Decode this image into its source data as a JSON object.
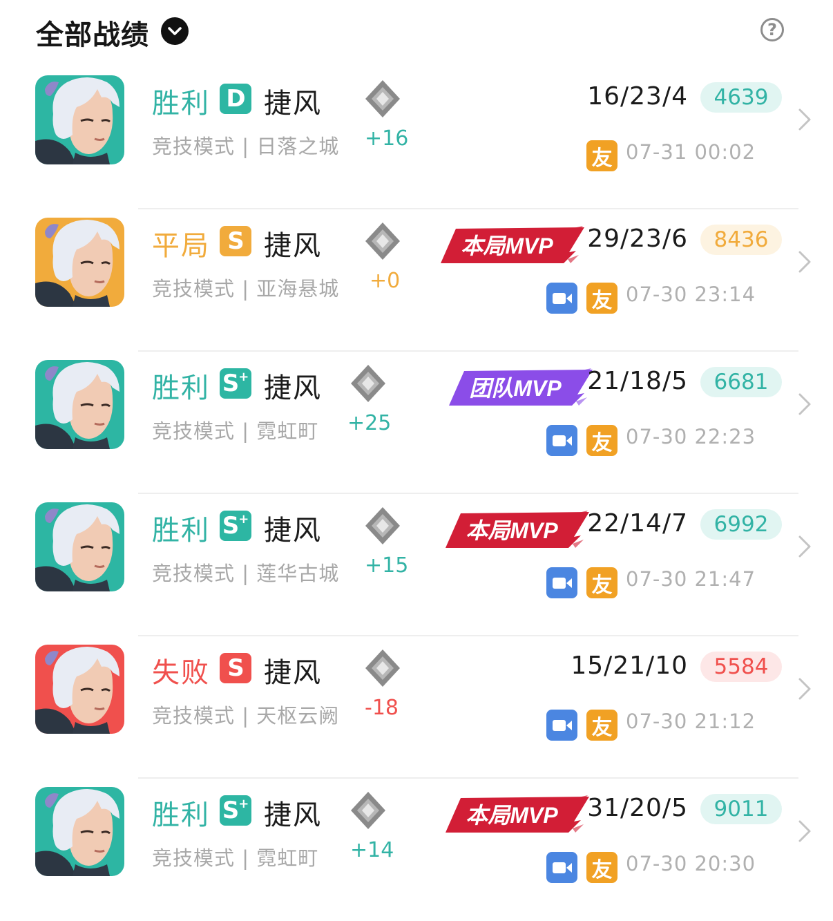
{
  "header": {
    "title": "全部战绩",
    "help_symbol": "?"
  },
  "colors": {
    "win": "#32b3a5",
    "draw": "#f1ab3c",
    "loss": "#f0504d",
    "grade_win": "#2db6a3",
    "grade_draw": "#f1ab3c",
    "grade_loss": "#f0504d",
    "score_win_bg": "#e1f5f2",
    "score_draw_bg": "#fdf3e1",
    "score_loss_bg": "#fde7e7",
    "mvp_match": "#d21e36",
    "mvp_team": "#8b4de8",
    "video": "#4b86e1",
    "friend": "#f1a124"
  },
  "matches": [
    {
      "result": "胜利",
      "outcome": "win",
      "grade": "D",
      "grade_plus": "",
      "hero": "捷风",
      "mode": "竞技模式 | 日落之城",
      "rank_change": "+16",
      "mvp": "",
      "kda": "16/23/4",
      "score": "4639",
      "has_video": false,
      "friend": "友",
      "time": "07-31 00:02"
    },
    {
      "result": "平局",
      "outcome": "draw",
      "grade": "S",
      "grade_plus": "",
      "hero": "捷风",
      "mode": "竞技模式 | 亚海悬城",
      "rank_change": "+0",
      "mvp": "本局MVP",
      "kda": "29/23/6",
      "score": "8436",
      "has_video": true,
      "friend": "友",
      "time": "07-30 23:14"
    },
    {
      "result": "胜利",
      "outcome": "win",
      "grade": "S",
      "grade_plus": "+",
      "hero": "捷风",
      "mode": "竞技模式 | 霓虹町",
      "rank_change": "+25",
      "mvp": "团队MVP",
      "kda": "21/18/5",
      "score": "6681",
      "has_video": true,
      "friend": "友",
      "time": "07-30 22:23"
    },
    {
      "result": "胜利",
      "outcome": "win",
      "grade": "S",
      "grade_plus": "+",
      "hero": "捷风",
      "mode": "竞技模式 | 莲华古城",
      "rank_change": "+15",
      "mvp": "本局MVP",
      "kda": "22/14/7",
      "score": "6992",
      "has_video": true,
      "friend": "友",
      "time": "07-30 21:47"
    },
    {
      "result": "失败",
      "outcome": "loss",
      "grade": "S",
      "grade_plus": "",
      "hero": "捷风",
      "mode": "竞技模式 | 天枢云阙",
      "rank_change": "-18",
      "mvp": "",
      "kda": "15/21/10",
      "score": "5584",
      "has_video": true,
      "friend": "友",
      "time": "07-30 21:12"
    },
    {
      "result": "胜利",
      "outcome": "win",
      "grade": "S",
      "grade_plus": "+",
      "hero": "捷风",
      "mode": "竞技模式 | 霓虹町",
      "rank_change": "+14",
      "mvp": "本局MVP",
      "kda": "31/20/5",
      "score": "9011",
      "has_video": true,
      "friend": "友",
      "time": "07-30 20:30"
    }
  ]
}
